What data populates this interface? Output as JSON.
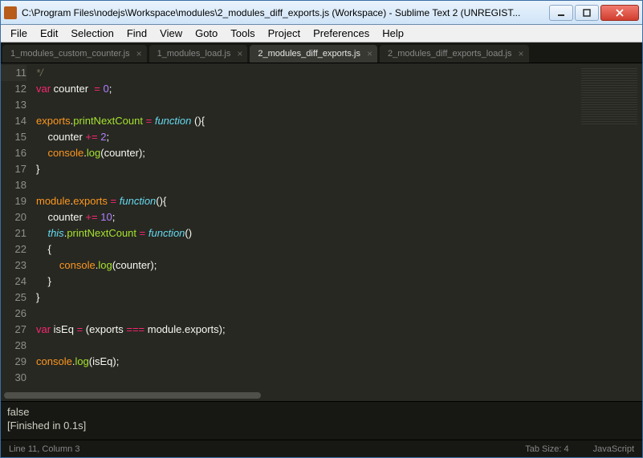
{
  "window": {
    "title": "C:\\Program Files\\nodejs\\Workspace\\modules\\2_modules_diff_exports.js (Workspace) - Sublime Text 2 (UNREGIST..."
  },
  "menu": [
    "File",
    "Edit",
    "Selection",
    "Find",
    "View",
    "Goto",
    "Tools",
    "Project",
    "Preferences",
    "Help"
  ],
  "tabs": [
    {
      "label": "1_modules_custom_counter.js",
      "active": false
    },
    {
      "label": "1_modules_load.js",
      "active": false
    },
    {
      "label": "2_modules_diff_exports.js",
      "active": true
    },
    {
      "label": "2_modules_diff_exports_load.js",
      "active": false
    }
  ],
  "gutter": {
    "start": 11,
    "end": 30,
    "dimRow": 11
  },
  "code": {
    "lines": [
      {
        "n": 11,
        "seg": [
          {
            "t": "*/",
            "c": "cm"
          }
        ]
      },
      {
        "n": 12,
        "seg": [
          {
            "t": "var ",
            "c": "kw"
          },
          {
            "t": "counter  ",
            "c": "pn"
          },
          {
            "t": "=",
            "c": "op"
          },
          {
            "t": " ",
            "c": "pn"
          },
          {
            "t": "0",
            "c": "nm"
          },
          {
            "t": ";",
            "c": "pn"
          }
        ]
      },
      {
        "n": 13,
        "seg": []
      },
      {
        "n": 14,
        "seg": [
          {
            "t": "exports",
            "c": "gl"
          },
          {
            "t": ".",
            "c": "pn"
          },
          {
            "t": "printNextCount",
            "c": "fn"
          },
          {
            "t": " ",
            "c": "pn"
          },
          {
            "t": "=",
            "c": "op"
          },
          {
            "t": " ",
            "c": "pn"
          },
          {
            "t": "function ",
            "c": "st"
          },
          {
            "t": "(){",
            "c": "pn"
          }
        ]
      },
      {
        "n": 15,
        "seg": [
          {
            "t": "    counter ",
            "c": "pn"
          },
          {
            "t": "+=",
            "c": "op"
          },
          {
            "t": " ",
            "c": "pn"
          },
          {
            "t": "2",
            "c": "nm"
          },
          {
            "t": ";",
            "c": "pn"
          }
        ]
      },
      {
        "n": 16,
        "seg": [
          {
            "t": "    console",
            "c": "gl"
          },
          {
            "t": ".",
            "c": "pn"
          },
          {
            "t": "log",
            "c": "fn"
          },
          {
            "t": "(counter);",
            "c": "pn"
          }
        ]
      },
      {
        "n": 17,
        "seg": [
          {
            "t": "}",
            "c": "pn"
          }
        ]
      },
      {
        "n": 18,
        "seg": []
      },
      {
        "n": 19,
        "seg": [
          {
            "t": "module",
            "c": "gl"
          },
          {
            "t": ".",
            "c": "pn"
          },
          {
            "t": "exports",
            "c": "gl"
          },
          {
            "t": " ",
            "c": "pn"
          },
          {
            "t": "=",
            "c": "op"
          },
          {
            "t": " ",
            "c": "pn"
          },
          {
            "t": "function",
            "c": "st"
          },
          {
            "t": "(){",
            "c": "pn"
          }
        ]
      },
      {
        "n": 20,
        "seg": [
          {
            "t": "    counter ",
            "c": "pn"
          },
          {
            "t": "+=",
            "c": "op"
          },
          {
            "t": " ",
            "c": "pn"
          },
          {
            "t": "10",
            "c": "nm"
          },
          {
            "t": ";",
            "c": "pn"
          }
        ]
      },
      {
        "n": 21,
        "seg": [
          {
            "t": "    ",
            "c": "pn"
          },
          {
            "t": "this",
            "c": "st"
          },
          {
            "t": ".",
            "c": "pn"
          },
          {
            "t": "printNextCount",
            "c": "fn"
          },
          {
            "t": " ",
            "c": "pn"
          },
          {
            "t": "=",
            "c": "op"
          },
          {
            "t": " ",
            "c": "pn"
          },
          {
            "t": "function",
            "c": "st"
          },
          {
            "t": "()",
            "c": "pn"
          }
        ]
      },
      {
        "n": 22,
        "seg": [
          {
            "t": "    {",
            "c": "pn"
          }
        ]
      },
      {
        "n": 23,
        "seg": [
          {
            "t": "        console",
            "c": "gl"
          },
          {
            "t": ".",
            "c": "pn"
          },
          {
            "t": "log",
            "c": "fn"
          },
          {
            "t": "(counter);",
            "c": "pn"
          }
        ]
      },
      {
        "n": 24,
        "seg": [
          {
            "t": "    }",
            "c": "pn"
          }
        ]
      },
      {
        "n": 25,
        "seg": [
          {
            "t": "}",
            "c": "pn"
          }
        ]
      },
      {
        "n": 26,
        "seg": []
      },
      {
        "n": 27,
        "seg": [
          {
            "t": "var ",
            "c": "kw"
          },
          {
            "t": "isEq ",
            "c": "pn"
          },
          {
            "t": "=",
            "c": "op"
          },
          {
            "t": " (exports ",
            "c": "pn"
          },
          {
            "t": "===",
            "c": "op"
          },
          {
            "t": " module.exports);",
            "c": "pn"
          }
        ]
      },
      {
        "n": 28,
        "seg": []
      },
      {
        "n": 29,
        "seg": [
          {
            "t": "console",
            "c": "gl"
          },
          {
            "t": ".",
            "c": "pn"
          },
          {
            "t": "log",
            "c": "fn"
          },
          {
            "t": "(isEq);",
            "c": "pn"
          }
        ]
      },
      {
        "n": 30,
        "seg": []
      }
    ]
  },
  "console": {
    "line1": "false",
    "line2": "[Finished in 0.1s]"
  },
  "status": {
    "position": "Line 11, Column 3",
    "tabsize": "Tab Size: 4",
    "syntax": "JavaScript"
  }
}
